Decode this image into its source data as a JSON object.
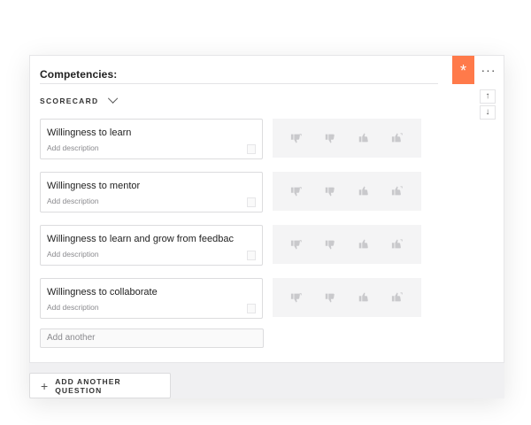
{
  "section": {
    "title": "Competencies:",
    "required_symbol": "*",
    "more_symbol": "···",
    "move_up_symbol": "↑",
    "move_down_symbol": "↓",
    "accent_color": "#ff7a4a"
  },
  "scorecard": {
    "label": "SCORECARD",
    "competencies": [
      {
        "name": "Willingness to learn",
        "description": "Add description"
      },
      {
        "name": "Willingness to mentor",
        "description": "Add description"
      },
      {
        "name": "Willingness to learn and grow from feedbac",
        "description": "Add description"
      },
      {
        "name": "Willingness to collaborate",
        "description": "Add description"
      }
    ],
    "rating_icons": [
      "double-thumbs-down-icon",
      "thumbs-down-icon",
      "thumbs-up-icon",
      "double-thumbs-up-icon"
    ],
    "add_another_placeholder": "Add another"
  },
  "footer": {
    "add_question_label": "ADD ANOTHER QUESTION",
    "add_question_symbol": "+"
  }
}
